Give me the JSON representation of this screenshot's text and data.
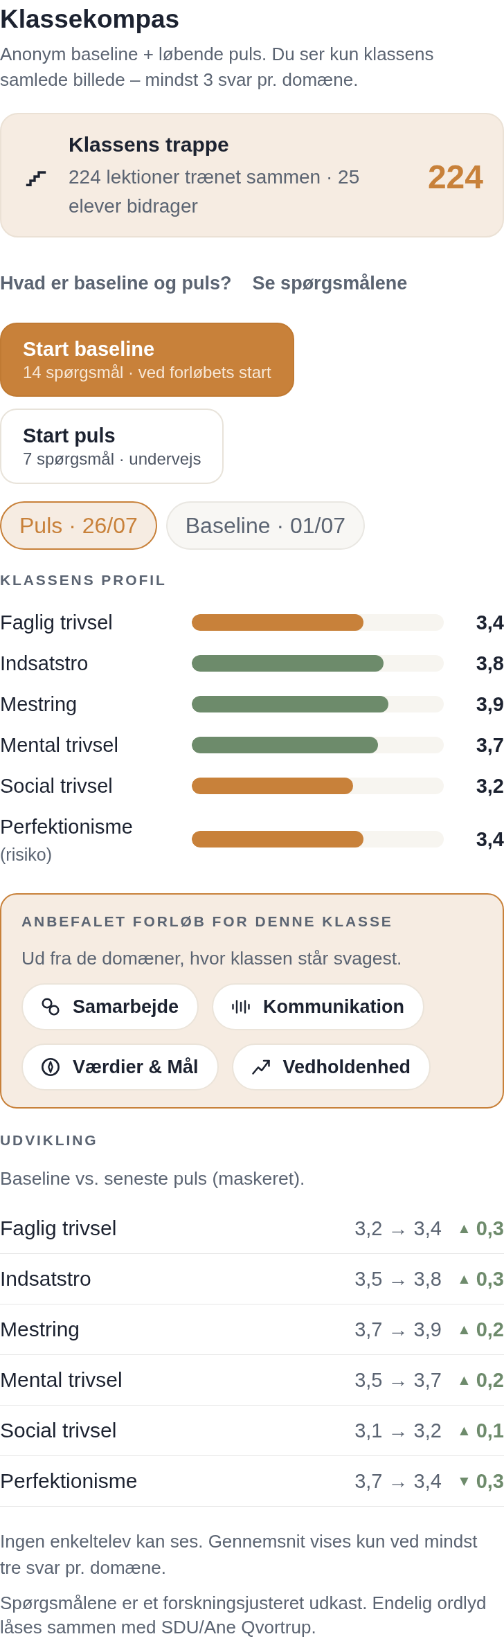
{
  "header": {
    "title": "Klassekompas",
    "subtitle": "Anonym baseline + løbende puls. Du ser kun klassens samlede billede – mindst 3 svar pr. domæne."
  },
  "staircase_card": {
    "title": "Klassens trappe",
    "text": "224 lektioner trænet sammen · 25 elever bidrager",
    "count": "224"
  },
  "links": [
    "Hvad er baseline og puls?",
    "Se spørgsmålene"
  ],
  "start_buttons": [
    {
      "kind": "primary",
      "title": "Start baseline",
      "subtitle": "14 spørgsmål · ved forløbets start"
    },
    {
      "kind": "secondary",
      "title": "Start puls",
      "subtitle": "7 spørgsmål · undervejs"
    }
  ],
  "measurement_tabs": [
    {
      "label": "Puls · 26/07",
      "selected": true
    },
    {
      "label": "Baseline · 01/07",
      "selected": false
    }
  ],
  "profile": {
    "heading": "KLASSENS PROFIL",
    "domains": [
      {
        "name": "Faglig trivsel",
        "level": 0.68,
        "value": "3,4",
        "color": "#c8813a"
      },
      {
        "name": "Indsatstro",
        "level": 0.76,
        "value": "3,8",
        "color": "#6d8b6b"
      },
      {
        "name": "Mestring",
        "level": 0.78,
        "value": "3,9",
        "color": "#6d8b6b"
      },
      {
        "name": "Mental trivsel",
        "level": 0.74,
        "value": "3,7",
        "color": "#6d8b6b"
      },
      {
        "name": "Social trivsel",
        "level": 0.64,
        "value": "3,2",
        "color": "#c8813a"
      },
      {
        "name": "Perfektionisme",
        "note": "(risiko)",
        "level": 0.68,
        "value": "3,4",
        "color": "#c8813a"
      }
    ]
  },
  "recommendation": {
    "heading": "ANBEFALET FORLØB FOR DENNE KLASSE",
    "text": "Ud fra de domæner, hvor klassen står svagest.",
    "courses": [
      "Samarbejde",
      "Kommunikation",
      "Værdier & Mål",
      "Vedholdenhed"
    ]
  },
  "development": {
    "heading": "UDVIKLING",
    "text": "Baseline vs. seneste puls (maskeret).",
    "rows": [
      {
        "name": "Faglig trivsel",
        "change": "3,2 → 3,4",
        "trend": "▲",
        "delta": "0,3"
      },
      {
        "name": "Indsatstro",
        "change": "3,5 → 3,8",
        "trend": "▲",
        "delta": "0,3"
      },
      {
        "name": "Mestring",
        "change": "3,7 → 3,9",
        "trend": "▲",
        "delta": "0,2"
      },
      {
        "name": "Mental trivsel",
        "change": "3,5 → 3,7",
        "trend": "▲",
        "delta": "0,2"
      },
      {
        "name": "Social trivsel",
        "change": "3,1 → 3,2",
        "trend": "▲",
        "delta": "0,1"
      },
      {
        "name": "Perfektionisme",
        "change": "3,7 → 3,4",
        "trend": "▼",
        "delta": "0,3"
      }
    ]
  },
  "footnotes": [
    "Ingen enkeltelev kan ses. Gennemsnit vises kun ved mindst tre svar pr. domæne.",
    "Spørgsmålene er et forskningsjusteret udkast. Endelig ordlyd låses sammen med SDU/Ane Qvortrup."
  ]
}
